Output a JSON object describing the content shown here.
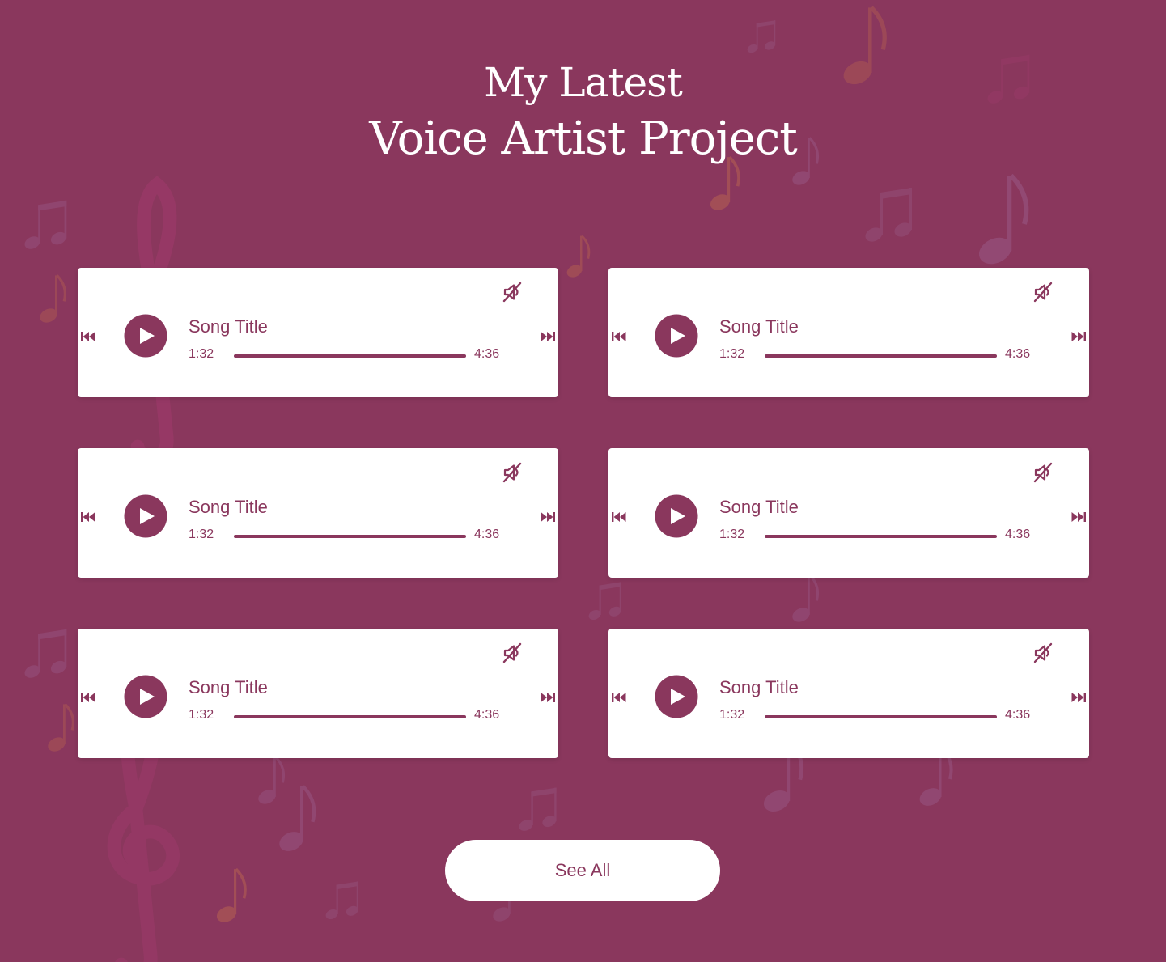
{
  "colors": {
    "background": "#8a375d",
    "accent": "#8a375d",
    "card": "#ffffff",
    "note_pink": "#a03a6c",
    "note_orange": "#c06a4e",
    "note_lilac": "#9a5c8a"
  },
  "header": {
    "title_line1": "My Latest",
    "title_line2": "Voice Artist Project"
  },
  "players": [
    {
      "title": "Song Title",
      "current_time": "1:32",
      "total_time": "4:36",
      "progress": 1.0,
      "prev_icon": "skip-previous-icon",
      "next_icon": "skip-next-icon",
      "play_icon": "play-icon",
      "mute_icon": "volume-mute-icon"
    },
    {
      "title": "Song Title",
      "current_time": "1:32",
      "total_time": "4:36",
      "progress": 1.0,
      "prev_icon": "skip-previous-icon",
      "next_icon": "skip-next-icon",
      "play_icon": "play-icon",
      "mute_icon": "volume-mute-icon"
    },
    {
      "title": "Song Title",
      "current_time": "1:32",
      "total_time": "4:36",
      "progress": 1.0,
      "prev_icon": "skip-previous-icon",
      "next_icon": "skip-next-icon",
      "play_icon": "play-icon",
      "mute_icon": "volume-mute-icon"
    },
    {
      "title": "Song Title",
      "current_time": "1:32",
      "total_time": "4:36",
      "progress": 1.0,
      "prev_icon": "skip-previous-icon",
      "next_icon": "skip-next-icon",
      "play_icon": "play-icon",
      "mute_icon": "volume-mute-icon"
    },
    {
      "title": "Song Title",
      "current_time": "1:32",
      "total_time": "4:36",
      "progress": 1.0,
      "prev_icon": "skip-previous-icon",
      "next_icon": "skip-next-icon",
      "play_icon": "play-icon",
      "mute_icon": "volume-mute-icon"
    },
    {
      "title": "Song Title",
      "current_time": "1:32",
      "total_time": "4:36",
      "progress": 1.0,
      "prev_icon": "skip-previous-icon",
      "next_icon": "skip-next-icon",
      "play_icon": "play-icon",
      "mute_icon": "volume-mute-icon"
    }
  ],
  "see_all": {
    "label": "See All"
  }
}
